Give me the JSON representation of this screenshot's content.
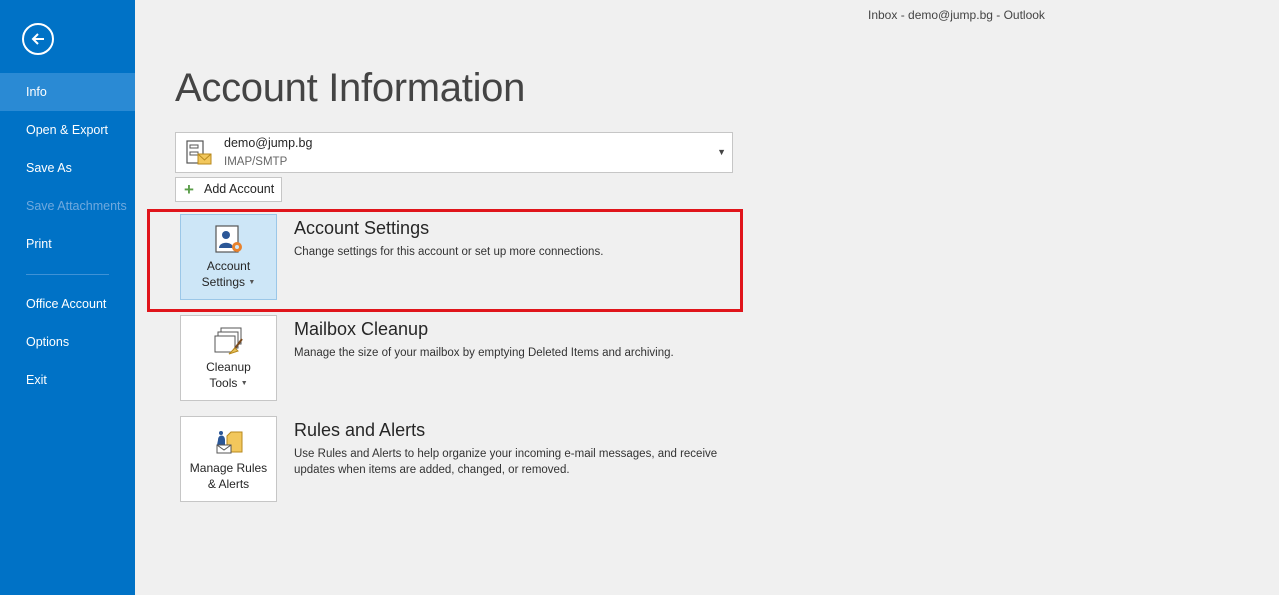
{
  "window": {
    "title": "Inbox - demo@jump.bg - Outlook"
  },
  "sidebar": {
    "items": [
      {
        "label": "Info"
      },
      {
        "label": "Open & Export"
      },
      {
        "label": "Save As"
      },
      {
        "label": "Save Attachments"
      },
      {
        "label": "Print"
      },
      {
        "label": "Office Account"
      },
      {
        "label": "Options"
      },
      {
        "label": "Exit"
      }
    ]
  },
  "page": {
    "title": "Account Information"
  },
  "account": {
    "email": "demo@jump.bg",
    "type": "IMAP/SMTP"
  },
  "add_account": {
    "label": "Add Account"
  },
  "sections": [
    {
      "button_line1": "Account",
      "button_line2": "Settings",
      "title": "Account Settings",
      "description": "Change settings for this account or set up more connections."
    },
    {
      "button_line1": "Cleanup",
      "button_line2": "Tools",
      "title": "Mailbox Cleanup",
      "description": "Manage the size of your mailbox by emptying Deleted Items and archiving."
    },
    {
      "button_line1": "Manage Rules",
      "button_line2": "& Alerts",
      "title": "Rules and Alerts",
      "description": "Use Rules and Alerts to help organize your incoming e-mail messages, and receive updates when items are added, changed, or removed."
    }
  ],
  "icons": {
    "back": "back-arrow-icon",
    "account_dropdown": "account-server-icon",
    "add": "plus-icon",
    "account_settings": "account-settings-icon",
    "cleanup": "cleanup-tools-icon",
    "rules": "rules-alerts-icon"
  },
  "colors": {
    "sidebar": "#0072c6",
    "sidebar_active": "#2a8ad4",
    "highlight_border": "#e0151b",
    "selected_tile": "#cde6f7"
  }
}
